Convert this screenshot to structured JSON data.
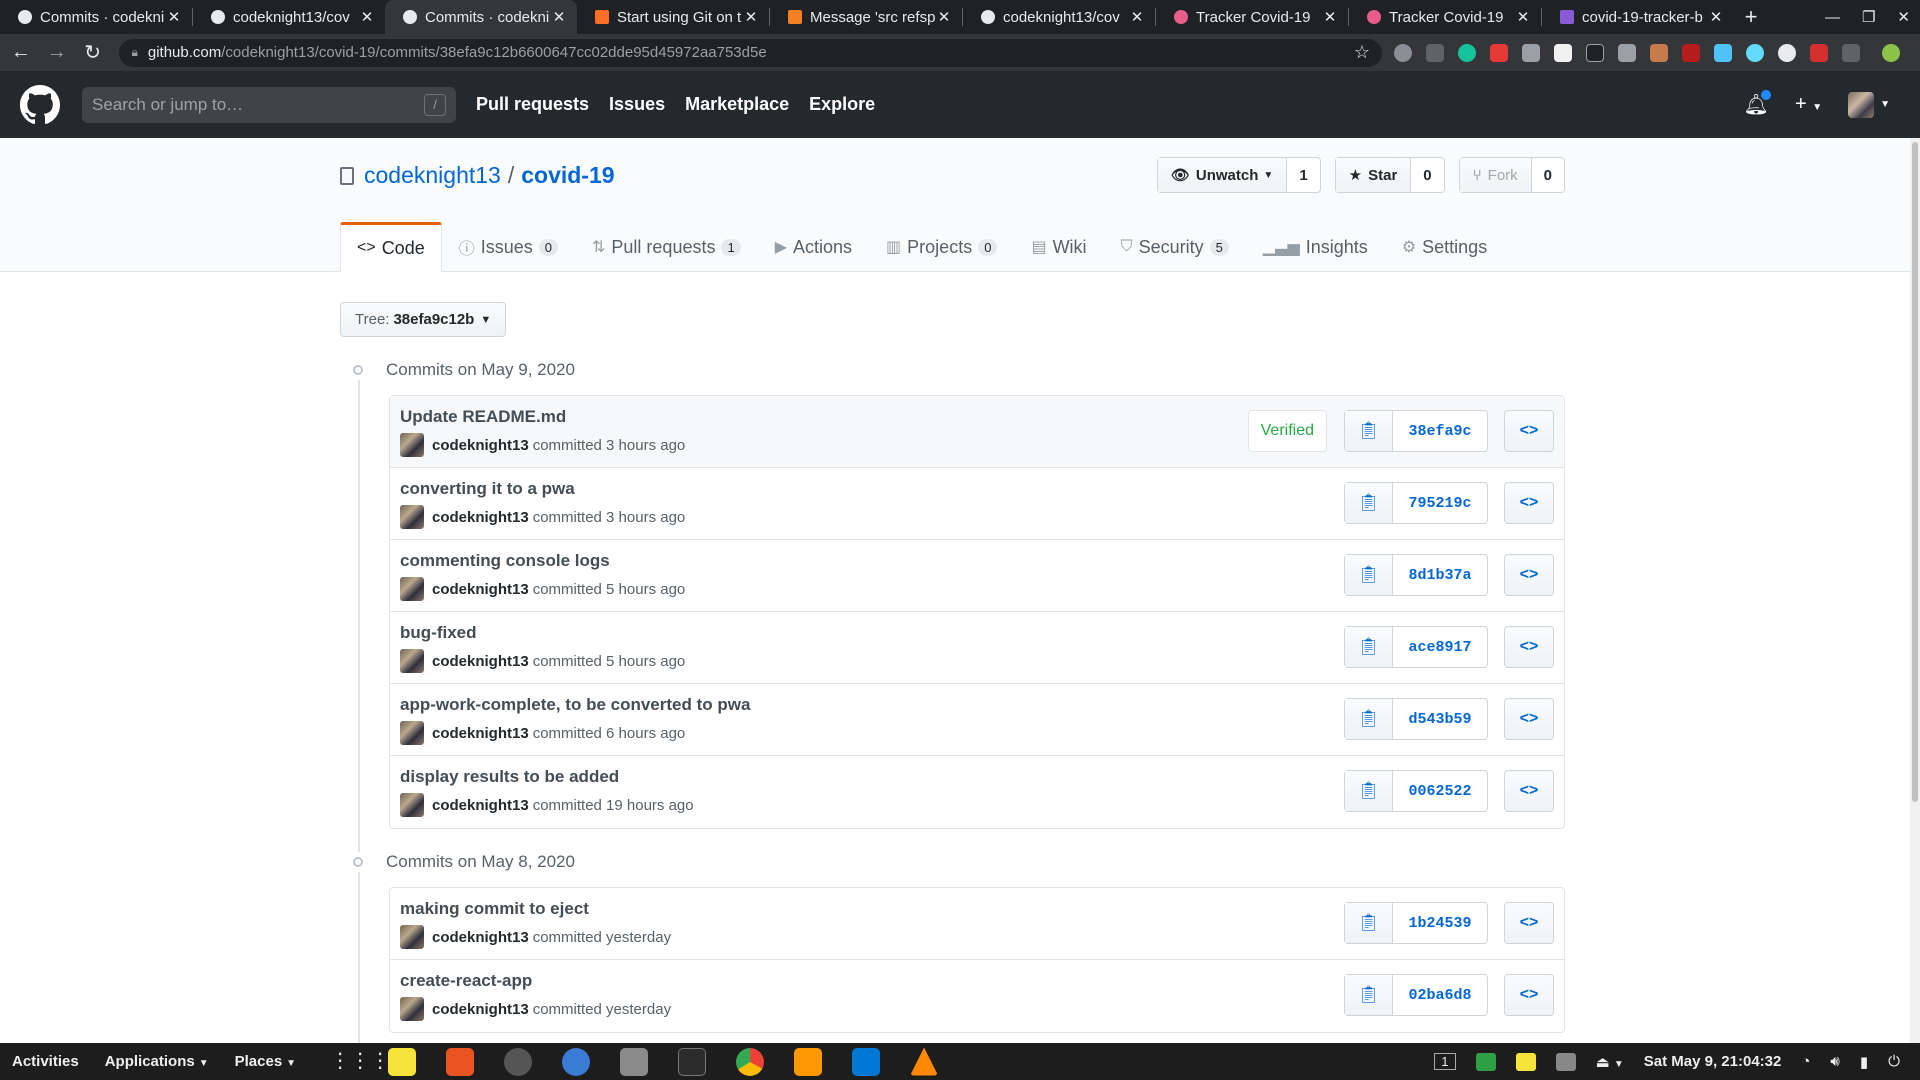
{
  "browser": {
    "tabs": [
      {
        "title": "Commits · codekni",
        "favicon": "github-icon",
        "active": false
      },
      {
        "title": "codeknight13/cov",
        "favicon": "github-icon",
        "active": false
      },
      {
        "title": "Commits · codekni",
        "favicon": "github-icon",
        "active": true
      },
      {
        "title": "Start using Git on t",
        "favicon": "gitlab-icon",
        "active": false
      },
      {
        "title": "Message 'src refsp",
        "favicon": "stackoverflow-icon",
        "active": false
      },
      {
        "title": "codeknight13/cov",
        "favicon": "github-icon",
        "active": false
      },
      {
        "title": "Tracker Covid-19",
        "favicon": "virus-icon",
        "active": false
      },
      {
        "title": "Tracker Covid-19",
        "favicon": "virus-icon",
        "active": false
      },
      {
        "title": "covid-19-tracker-b",
        "favicon": "heroku-icon",
        "active": false
      }
    ],
    "url_host": "github.com",
    "url_path": "/codeknight13/covid-19/commits/38efa9c12b6600647cc02dde95d45972aa753d5e"
  },
  "github": {
    "search_placeholder": "Search or jump to…",
    "search_key": "/",
    "nav": [
      "Pull requests",
      "Issues",
      "Marketplace",
      "Explore"
    ]
  },
  "repo": {
    "owner": "codeknight13",
    "separator": "/",
    "name": "covid-19",
    "watch": {
      "label": "Unwatch",
      "count": "1"
    },
    "star": {
      "label": "Star",
      "count": "0"
    },
    "fork": {
      "label": "Fork",
      "count": "0"
    },
    "tabs": [
      {
        "label": "Code",
        "icon": "code-icon",
        "count": null
      },
      {
        "label": "Issues",
        "icon": "issue-icon",
        "count": "0"
      },
      {
        "label": "Pull requests",
        "icon": "pull-request-icon",
        "count": "1"
      },
      {
        "label": "Actions",
        "icon": "play-icon",
        "count": null
      },
      {
        "label": "Projects",
        "icon": "project-icon",
        "count": "0"
      },
      {
        "label": "Wiki",
        "icon": "book-icon",
        "count": null
      },
      {
        "label": "Security",
        "icon": "shield-icon",
        "count": "5"
      },
      {
        "label": "Insights",
        "icon": "graph-icon",
        "count": null
      },
      {
        "label": "Settings",
        "icon": "gear-icon",
        "count": null
      }
    ]
  },
  "tree": {
    "label": "Tree:",
    "value": "38efa9c12b"
  },
  "commit_groups": [
    {
      "heading": "Commits on May 9, 2020",
      "commits": [
        {
          "message": "Update README.md",
          "author": "codeknight13",
          "action": "committed",
          "when": "3 hours ago",
          "verified": "Verified",
          "sha": "38efa9c"
        },
        {
          "message": "converting it to a pwa",
          "author": "codeknight13",
          "action": "committed",
          "when": "3 hours ago",
          "verified": null,
          "sha": "795219c"
        },
        {
          "message": "commenting console logs",
          "author": "codeknight13",
          "action": "committed",
          "when": "5 hours ago",
          "verified": null,
          "sha": "8d1b37a"
        },
        {
          "message": "bug-fixed",
          "author": "codeknight13",
          "action": "committed",
          "when": "5 hours ago",
          "verified": null,
          "sha": "ace8917"
        },
        {
          "message": "app-work-complete, to be converted to pwa",
          "author": "codeknight13",
          "action": "committed",
          "when": "6 hours ago",
          "verified": null,
          "sha": "d543b59"
        },
        {
          "message": "display results to be added",
          "author": "codeknight13",
          "action": "committed",
          "when": "19 hours ago",
          "verified": null,
          "sha": "0062522"
        }
      ]
    },
    {
      "heading": "Commits on May 8, 2020",
      "commits": [
        {
          "message": "making commit to eject",
          "author": "codeknight13",
          "action": "committed",
          "when": "yesterday",
          "verified": null,
          "sha": "1b24539"
        },
        {
          "message": "create-react-app",
          "author": "codeknight13",
          "action": "committed",
          "when": "yesterday",
          "verified": null,
          "sha": "02ba6d8"
        }
      ]
    }
  ],
  "taskbar": {
    "activities": "Activities",
    "applications": "Applications",
    "places": "Places",
    "workspace": "1",
    "clock": "Sat May  9, 21:04:32"
  },
  "colors": {
    "header_bg": "#24292e",
    "link": "#0366d6",
    "verified": "#28a745",
    "active_tab_border": "#e36209"
  }
}
